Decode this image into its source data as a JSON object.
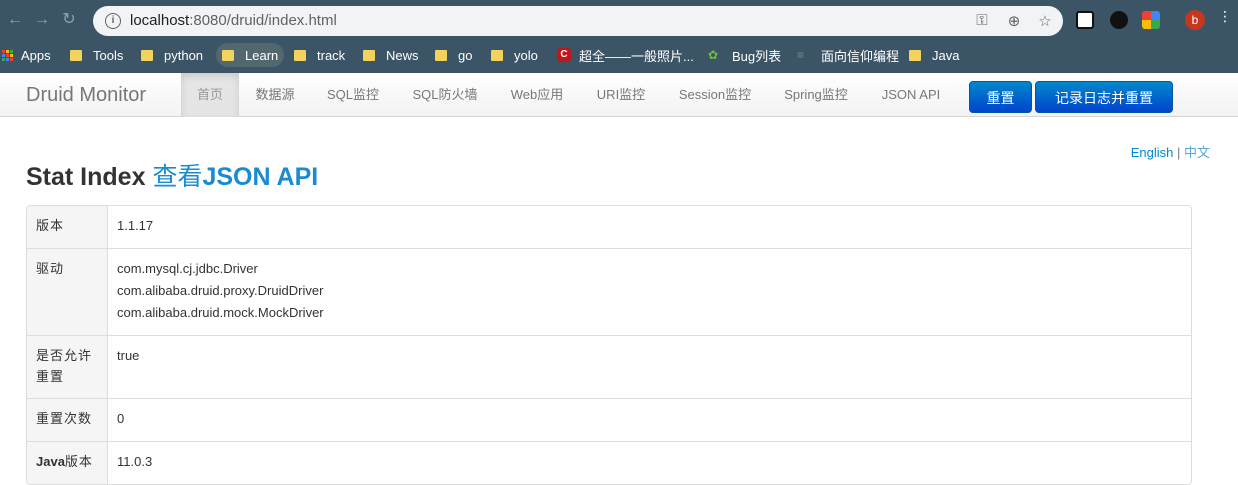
{
  "browser": {
    "url_host": "localhost",
    "url_path": ":8080/druid/index.html",
    "profile_initial": "b",
    "bookmarks": {
      "apps": "Apps",
      "tools": "Tools",
      "python": "python",
      "learn": "Learn",
      "track": "track",
      "news": "News",
      "go": "go",
      "yolo": "yolo",
      "super": "超全——一般照片...",
      "bug": "Bug列表",
      "oop": "面向信仰编程",
      "java": "Java"
    }
  },
  "navbar": {
    "brand": "Druid Monitor",
    "items": [
      "首页",
      "数据源",
      "SQL监控",
      "SQL防火墙",
      "Web应用",
      "URI监控",
      "Session监控",
      "Spring监控",
      "JSON API"
    ],
    "reset_button": "重置",
    "log_reset_button": "记录日志并重置"
  },
  "lang": {
    "english": "English",
    "separator": "|",
    "chinese": "中文"
  },
  "header": {
    "title": "Stat Index",
    "link_cn": "查看",
    "link_en": "JSON API"
  },
  "table": {
    "version": {
      "label": "版本",
      "value": "1.1.17"
    },
    "driver": {
      "label": "驱动",
      "values": [
        "com.mysql.cj.jdbc.Driver",
        "com.alibaba.druid.proxy.DruidDriver",
        "com.alibaba.druid.mock.MockDriver"
      ]
    },
    "allow_reset": {
      "label_line1": "是否允许",
      "label_line2": "重置",
      "value": "true"
    },
    "reset_count": {
      "label": "重置次数",
      "value": "0"
    },
    "java_version": {
      "label_bold": "Java",
      "label_rest": "版本",
      "value": "11.0.3"
    }
  }
}
